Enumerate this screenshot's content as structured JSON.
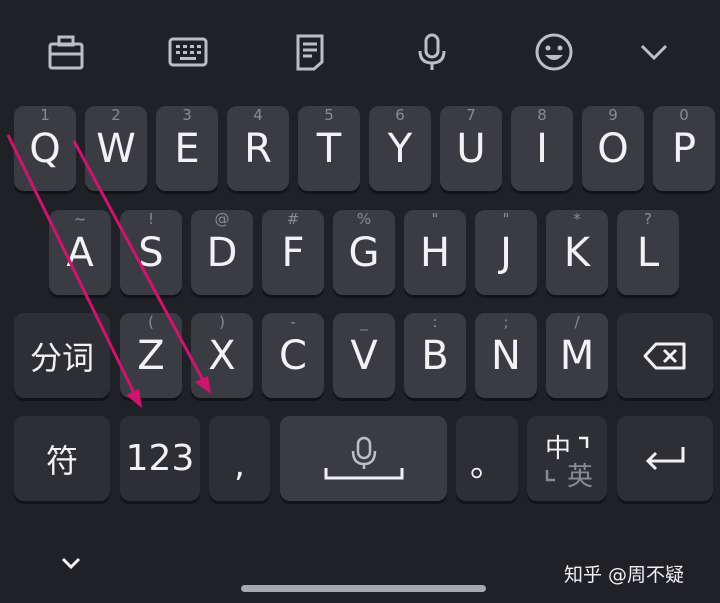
{
  "toolbar": {
    "icons": [
      "clipboard-icon",
      "keyboard-icon",
      "document-icon",
      "microphone-icon",
      "emoji-icon",
      "chevron-down-icon"
    ]
  },
  "rows": {
    "row1": [
      {
        "letter": "Q",
        "hint": "1"
      },
      {
        "letter": "W",
        "hint": "2"
      },
      {
        "letter": "E",
        "hint": "3"
      },
      {
        "letter": "R",
        "hint": "4"
      },
      {
        "letter": "T",
        "hint": "5"
      },
      {
        "letter": "Y",
        "hint": "6"
      },
      {
        "letter": "U",
        "hint": "7"
      },
      {
        "letter": "I",
        "hint": "8"
      },
      {
        "letter": "O",
        "hint": "9"
      },
      {
        "letter": "P",
        "hint": "0"
      }
    ],
    "row2": [
      {
        "letter": "A",
        "hint": "~"
      },
      {
        "letter": "S",
        "hint": "!"
      },
      {
        "letter": "D",
        "hint": "@"
      },
      {
        "letter": "F",
        "hint": "#"
      },
      {
        "letter": "G",
        "hint": "%"
      },
      {
        "letter": "H",
        "hint": "\""
      },
      {
        "letter": "J",
        "hint": "\""
      },
      {
        "letter": "K",
        "hint": "*"
      },
      {
        "letter": "L",
        "hint": "?"
      }
    ],
    "row3": [
      {
        "letter": "Z",
        "hint": "("
      },
      {
        "letter": "X",
        "hint": ")"
      },
      {
        "letter": "C",
        "hint": "-"
      },
      {
        "letter": "V",
        "hint": "_"
      },
      {
        "letter": "B",
        "hint": ":"
      },
      {
        "letter": "N",
        "hint": ";"
      },
      {
        "letter": "M",
        "hint": "/"
      }
    ]
  },
  "special": {
    "segment": "分词",
    "symbols": "符",
    "numbers": "123",
    "comma": ",",
    "period": "。",
    "lang_zh": "中",
    "lang_en": "英"
  },
  "watermark": "知乎 @周不疑",
  "colors": {
    "background": "#202126",
    "key": "#3b3c43",
    "key_dark": "#2e2f35",
    "annotation_arrow": "#d0136f"
  }
}
